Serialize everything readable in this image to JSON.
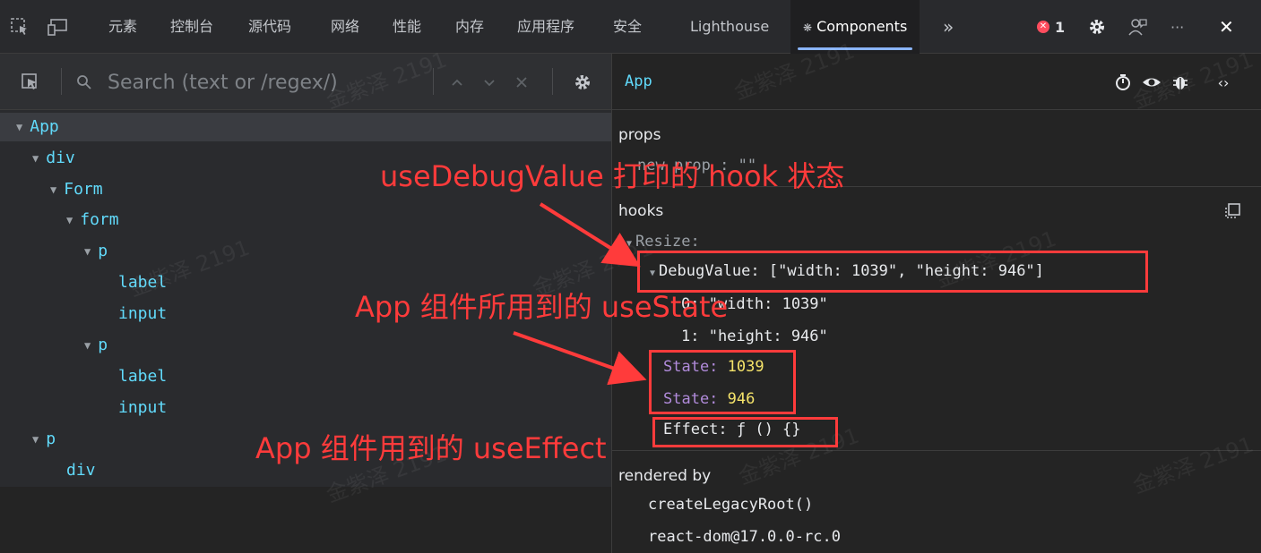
{
  "tabs": [
    {
      "label": "元素"
    },
    {
      "label": "控制台"
    },
    {
      "label": "源代码"
    },
    {
      "label": "网络"
    },
    {
      "label": "性能"
    },
    {
      "label": "内存"
    },
    {
      "label": "应用程序"
    },
    {
      "label": "安全"
    },
    {
      "label": "Lighthouse"
    },
    {
      "label": "Components"
    }
  ],
  "topbar": {
    "more_tabs": "»",
    "error_count": "1",
    "more_menu": "···",
    "close": "✕"
  },
  "search": {
    "placeholder": "Search (text or /regex/)"
  },
  "tree": [
    {
      "name": "App",
      "expanded": true
    },
    {
      "name": "div",
      "expanded": true
    },
    {
      "name": "Form",
      "expanded": true
    },
    {
      "name": "form",
      "expanded": true
    },
    {
      "name": "p",
      "expanded": true
    },
    {
      "name": "label",
      "expanded": false
    },
    {
      "name": "input",
      "expanded": false
    },
    {
      "name": "p",
      "expanded": true
    },
    {
      "name": "label",
      "expanded": false
    },
    {
      "name": "input",
      "expanded": false
    },
    {
      "name": "p",
      "expanded": true
    },
    {
      "name": "div",
      "expanded": false
    }
  ],
  "inspector": {
    "component_name": "App",
    "props_label": "props",
    "props_row": "new prop : \"\"",
    "hooks_label": "hooks",
    "hooks": {
      "resize": "Resize:",
      "debug_value": "DebugValue: [\"width: 1039\", \"height: 946\"]",
      "item0": "0: \"width: 1039\"",
      "item1": "1: \"height: 946\"",
      "state_key": "State:",
      "state1_value": "1039",
      "state2_value": "946",
      "effect": "Effect: ƒ () {}"
    },
    "rendered_by_label": "rendered by",
    "rendered_by": [
      "createLegacyRoot()",
      "react-dom@17.0.0-rc.0"
    ]
  },
  "annotations": {
    "debug_value": "useDebugValue 打印的 hook 状态",
    "use_state": "App 组件所用到的 useState",
    "use_effect": "App 组件用到的 useEffect"
  },
  "watermark": "金紫泽 2191",
  "colors": {
    "accent": "#61dafb",
    "annotation": "#ff3b3b",
    "hook_key": "#b18bdb",
    "hook_number": "#f5e36a",
    "error": "#ff4d5e",
    "tab_underline": "#8ab4f8"
  }
}
